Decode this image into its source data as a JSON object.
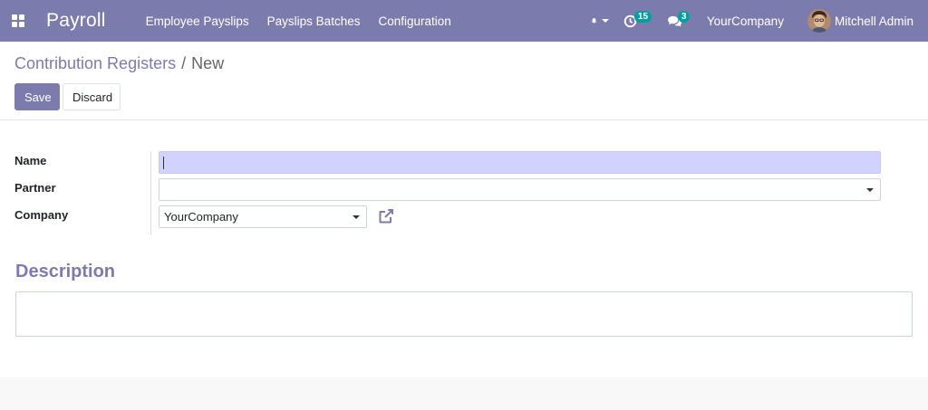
{
  "navbar": {
    "app_name": "Payroll",
    "menu": [
      {
        "label": "Employee Payslips"
      },
      {
        "label": "Payslips Batches"
      },
      {
        "label": "Configuration"
      }
    ],
    "activity_count": "15",
    "message_count": "3",
    "company": "YourCompany",
    "user_name": "Mitchell Admin",
    "accent_color": "#7c7bad",
    "badge_color": "#00a09d"
  },
  "breadcrumb": {
    "parent": "Contribution Registers",
    "separator": "/",
    "current": "New"
  },
  "actions": {
    "save_label": "Save",
    "discard_label": "Discard"
  },
  "form": {
    "name_label": "Name",
    "name_value": "",
    "partner_label": "Partner",
    "partner_value": "",
    "company_label": "Company",
    "company_value": "YourCompany",
    "description_title": "Description",
    "description_value": ""
  },
  "icons": {
    "apps": "apps-grid-icon",
    "notifications": "bell-icon",
    "activities": "clock-icon",
    "messages": "chat-icon",
    "external_link": "external-link-icon"
  }
}
